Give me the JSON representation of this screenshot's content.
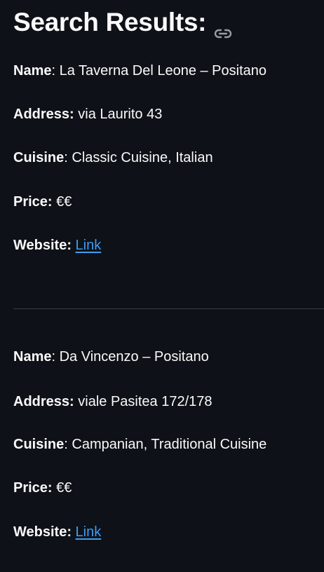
{
  "header": {
    "title": "Search Results:",
    "icon": "link-icon"
  },
  "results": [
    {
      "name_label": "Name",
      "name": "La Taverna Del Leone – Positano",
      "address_label": "Address:",
      "address": "via Laurito 43",
      "cuisine_label": "Cuisine",
      "cuisine": "Classic Cuisine, Italian",
      "price_label": "Price:",
      "price": "€€",
      "website_label": "Website:",
      "website_link": "Link"
    },
    {
      "name_label": "Name",
      "name": "Da Vincenzo – Positano",
      "address_label": "Address:",
      "address": "viale Pasitea 172/178",
      "cuisine_label": "Cuisine",
      "cuisine": "Campanian, Traditional Cuisine",
      "price_label": "Price:",
      "price": "€€",
      "website_label": "Website:",
      "website_link": "Link"
    }
  ],
  "colors": {
    "background": "#0e1117",
    "text": "#fafafa",
    "link": "#3d9df3",
    "divider": "#3a3d45"
  }
}
